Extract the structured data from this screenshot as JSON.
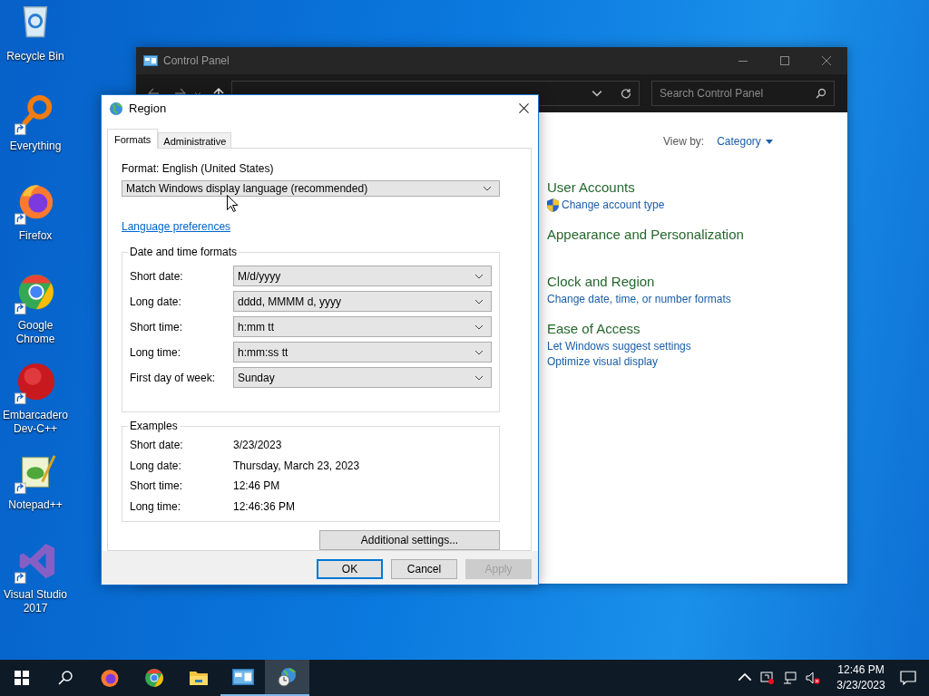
{
  "desktop": {
    "icons": [
      {
        "label": "Recycle Bin",
        "shortcut": false
      },
      {
        "label": "Everything",
        "shortcut": true
      },
      {
        "label": "Firefox",
        "shortcut": true
      },
      {
        "label": "Google Chrome",
        "shortcut": true
      },
      {
        "label": "Embarcadero Dev-C++",
        "shortcut": true
      },
      {
        "label": "Notepad++",
        "shortcut": true
      },
      {
        "label": "Visual Studio 2017",
        "shortcut": true
      }
    ]
  },
  "control_panel": {
    "title": "Control Panel",
    "search": {
      "placeholder": "Search Control Panel"
    },
    "view_by": {
      "label": "View by:",
      "value": "Category"
    },
    "categories": [
      {
        "title": "User Accounts",
        "links": [
          {
            "label": "Change account type",
            "shield": true
          }
        ]
      },
      {
        "title": "Appearance and Personalization"
      },
      {
        "title": "Clock and Region",
        "links": [
          {
            "label": "Change date, time, or number formats",
            "shield": false
          }
        ]
      },
      {
        "title": "Ease of Access",
        "links": [
          {
            "label": "Let Windows suggest settings",
            "shield": false
          },
          {
            "label": "Optimize visual display",
            "shield": false
          }
        ]
      }
    ]
  },
  "region_dialog": {
    "title": "Region",
    "tabs": [
      {
        "label": "Formats",
        "selected": true
      },
      {
        "label": "Administrative",
        "selected": false
      }
    ],
    "format_label": "Format: English (United States)",
    "format_value": "Match Windows display language (recommended)",
    "language_link": "Language preferences",
    "formats_group": {
      "title": "Date and time formats",
      "rows": [
        {
          "label": "Short date:",
          "value": "M/d/yyyy"
        },
        {
          "label": "Long date:",
          "value": "dddd, MMMM d, yyyy"
        },
        {
          "label": "Short time:",
          "value": "h:mm tt"
        },
        {
          "label": "Long time:",
          "value": "h:mm:ss tt"
        },
        {
          "label": "First day of week:",
          "value": "Sunday"
        }
      ]
    },
    "examples_group": {
      "title": "Examples",
      "rows": [
        {
          "label": "Short date:",
          "value": "3/23/2023"
        },
        {
          "label": "Long date:",
          "value": "Thursday, March 23, 2023"
        },
        {
          "label": "Short time:",
          "value": "12:46 PM"
        },
        {
          "label": "Long time:",
          "value": "12:46:36 PM"
        }
      ]
    },
    "additional_button": "Additional settings...",
    "buttons": [
      {
        "label": "OK",
        "default": true,
        "disabled": false
      },
      {
        "label": "Cancel",
        "default": false,
        "disabled": false
      },
      {
        "label": "Apply",
        "default": false,
        "disabled": true
      }
    ]
  },
  "taskbar": {
    "apps": [
      {
        "running": false,
        "selected": false
      },
      {
        "running": false,
        "selected": false
      },
      {
        "running": false,
        "selected": false
      },
      {
        "running": true,
        "selected": false
      },
      {
        "running": true,
        "selected": true
      }
    ],
    "clock": {
      "time": "12:46 PM",
      "date": "3/23/2023"
    }
  }
}
